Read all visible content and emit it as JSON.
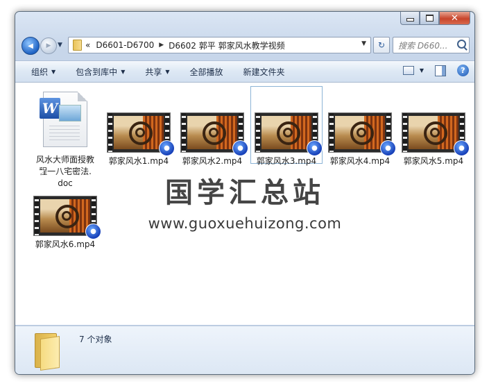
{
  "window": {
    "caption": {
      "minimize": "",
      "maximize": "",
      "close": "✕"
    }
  },
  "nav": {
    "back_glyph": "◀",
    "forward_glyph": "▶",
    "address": {
      "overflow": "«",
      "crumb1": "D6601-D6700",
      "sep": "▶",
      "crumb2": "D6602 郭平 郭家风水教学视频"
    },
    "refresh_glyph": "↻",
    "search_placeholder": "搜索 D660..."
  },
  "toolbar": {
    "organize": "组织",
    "include_in_library": "包含到库中",
    "share": "共享",
    "play_all": "全部播放",
    "new_folder": "新建文件夹"
  },
  "files": [
    {
      "name": "风水大师面授教程一八宅密法.doc",
      "type": "doc"
    },
    {
      "name": "郭家风水1.mp4",
      "type": "video"
    },
    {
      "name": "郭家风水2.mp4",
      "type": "video"
    },
    {
      "name": "郭家风水3.mp4",
      "type": "video",
      "selected": true
    },
    {
      "name": "郭家风水4.mp4",
      "type": "video"
    },
    {
      "name": "郭家风水5.mp4",
      "type": "video"
    },
    {
      "name": "郭家风水6.mp4",
      "type": "video"
    }
  ],
  "doc_label_lines": [
    "风水大师面授教",
    "程一八宅密法.",
    "doc"
  ],
  "watermark": {
    "title": "国学汇总站",
    "url": "www.guoxuehuizong.com"
  },
  "status": {
    "count": "7 个对象"
  },
  "colors": {
    "accent": "#1f63c4",
    "selection_border": "#8cb4d6",
    "close_button": "#c8452b"
  }
}
